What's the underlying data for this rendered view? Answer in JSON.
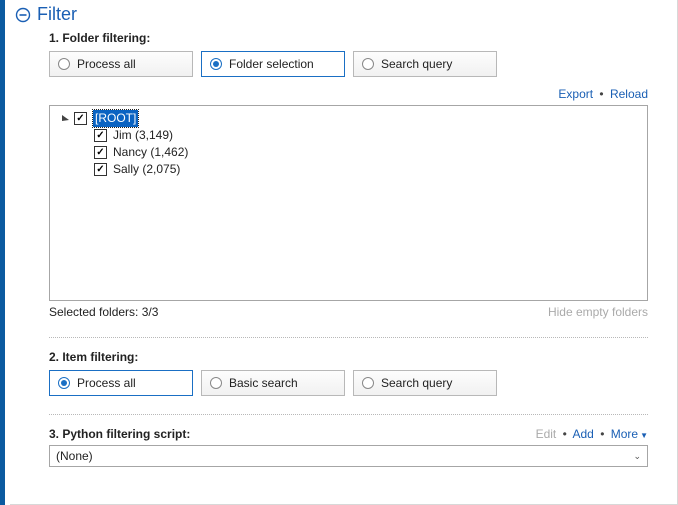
{
  "header": {
    "title": "Filter"
  },
  "folder_filtering": {
    "title": "1. Folder filtering:",
    "options": {
      "process_all": "Process all",
      "folder_selection": "Folder selection",
      "search_query": "Search query"
    },
    "links": {
      "export": "Export",
      "reload": "Reload"
    },
    "tree": {
      "root": {
        "label": "[ROOT]"
      },
      "children": [
        {
          "label": "Jim (3,149)"
        },
        {
          "label": "Nancy (1,462)"
        },
        {
          "label": "Sally (2,075)"
        }
      ]
    },
    "status": "Selected folders: 3/3",
    "hide_empty": "Hide empty folders"
  },
  "item_filtering": {
    "title": "2. Item filtering:",
    "options": {
      "process_all": "Process all",
      "basic_search": "Basic search",
      "search_query": "Search query"
    }
  },
  "python_script": {
    "title": "3. Python filtering script:",
    "links": {
      "edit": "Edit",
      "add": "Add",
      "more": "More"
    },
    "selected": "(None)"
  }
}
